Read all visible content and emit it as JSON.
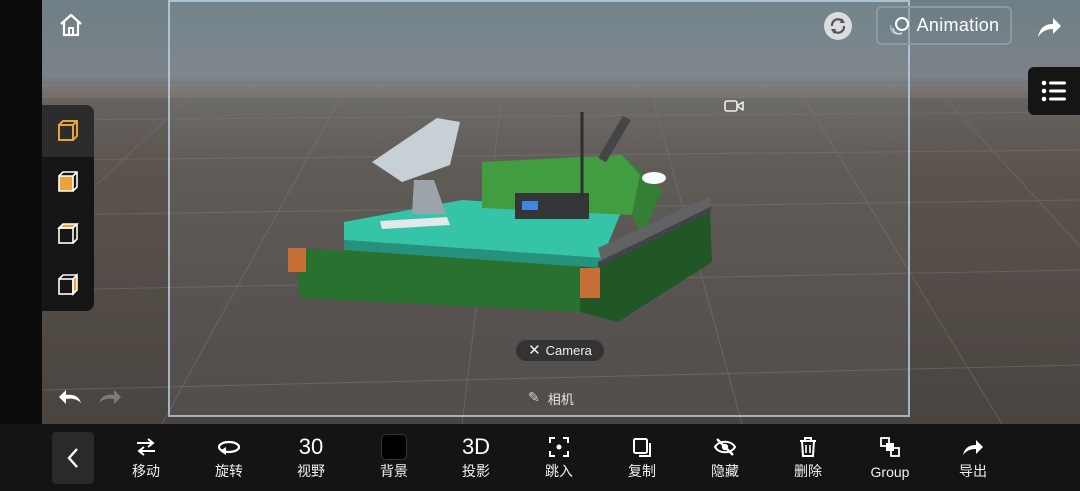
{
  "top_bar": {
    "animation_label": "Animation",
    "icons": [
      "home-icon",
      "refresh-icon",
      "share-icon",
      "list-menu-icon"
    ]
  },
  "scene": {
    "camera_pill_label": "Camera",
    "camera_name": "相机"
  },
  "view_panel": {
    "items": [
      "view-cube-front",
      "view-cube-right",
      "view-cube-top",
      "view-cube-left"
    ]
  },
  "toolbar": {
    "items": [
      {
        "id": "move",
        "label": "移动"
      },
      {
        "id": "rotate",
        "label": "旋转"
      },
      {
        "id": "fov",
        "value": "30",
        "label": "视野"
      },
      {
        "id": "background",
        "label": "背景"
      },
      {
        "id": "projection",
        "value": "3D",
        "label": "投影"
      },
      {
        "id": "jump",
        "label": "跳入"
      },
      {
        "id": "copy",
        "label": "复制"
      },
      {
        "id": "hide",
        "label": "隐藏"
      },
      {
        "id": "delete",
        "label": "删除"
      },
      {
        "id": "group",
        "label": "Group"
      },
      {
        "id": "export",
        "label": "导出"
      }
    ]
  },
  "colors": {
    "accent_orange": "#e8a33c",
    "toolbar_bg": "#141414",
    "tank_green": "#2f8a2f",
    "platform_teal": "#2ec4a6"
  }
}
